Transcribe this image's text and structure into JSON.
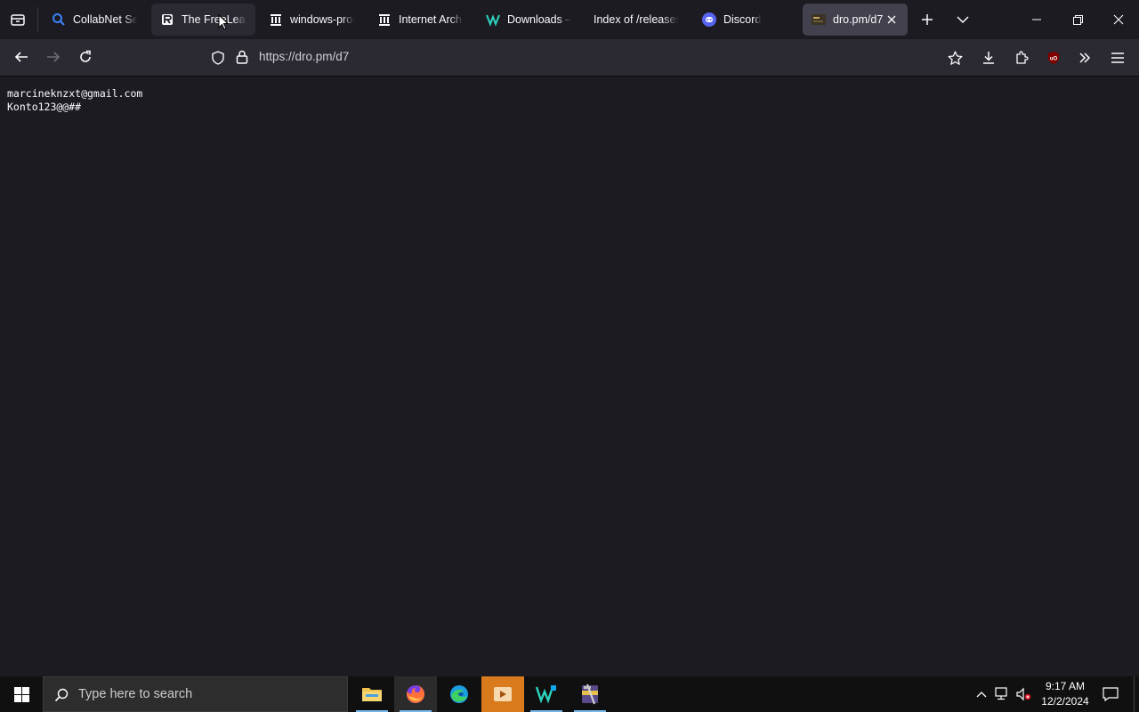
{
  "browser": {
    "tabs": [
      {
        "label": "CollabNet Search",
        "icon": "search-icon",
        "state": "normal"
      },
      {
        "label": "The FreeLeak",
        "icon": "freeleak-logo-icon",
        "state": "hover"
      },
      {
        "label": "windows-programs",
        "icon": "archive-building-icon",
        "state": "normal"
      },
      {
        "label": "Internet Archive",
        "icon": "archive-building-icon",
        "state": "normal"
      },
      {
        "label": "Downloads – Cyber",
        "icon": "cyber-logo-icon",
        "state": "normal"
      },
      {
        "label": "Index of /releases/",
        "icon": "",
        "state": "normal"
      },
      {
        "label": "Discord",
        "icon": "discord-icon",
        "state": "normal"
      },
      {
        "label": "dro.pm/d7",
        "icon": "page-thumbnail-icon",
        "state": "active"
      }
    ],
    "url": "https://dro.pm/d7"
  },
  "page": {
    "lines": [
      "marcineknzxt@gmail.com",
      "Konto123@@##"
    ]
  },
  "taskbar": {
    "search_placeholder": "Type here to search",
    "apps": [
      "file-explorer-icon",
      "firefox-icon",
      "edge-icon",
      "media-player-icon",
      "vscode-like-icon",
      "winrar-icon"
    ],
    "clock": {
      "time": "9:17 AM",
      "date": "12/2/2024"
    }
  },
  "colors": {
    "accent": "#76b9ed",
    "page_bg": "#1c1b22",
    "toolbar_bg": "#2b2a33",
    "active_tab": "#42414d",
    "ublock_red": "#800000"
  }
}
